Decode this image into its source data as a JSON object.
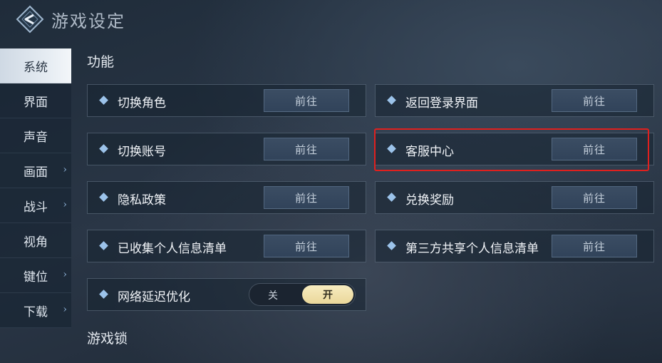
{
  "header": {
    "title": "游戏设定",
    "back_icon": "back-arrow-icon"
  },
  "sidebar": {
    "items": [
      {
        "label": "系统",
        "active": true,
        "has_chevron": false
      },
      {
        "label": "界面",
        "active": false,
        "has_chevron": false
      },
      {
        "label": "声音",
        "active": false,
        "has_chevron": false
      },
      {
        "label": "画面",
        "active": false,
        "has_chevron": true
      },
      {
        "label": "战斗",
        "active": false,
        "has_chevron": true
      },
      {
        "label": "视角",
        "active": false,
        "has_chevron": false
      },
      {
        "label": "键位",
        "active": false,
        "has_chevron": true
      },
      {
        "label": "下载",
        "active": false,
        "has_chevron": true
      }
    ],
    "chevron_glyph": "›"
  },
  "sections": {
    "function_title": "功能",
    "lock_title": "游戏锁"
  },
  "rows": {
    "switch_role": {
      "label": "切换角色",
      "button": "前往"
    },
    "back_to_login": {
      "label": "返回登录界面",
      "button": "前往"
    },
    "switch_account": {
      "label": "切换账号",
      "button": "前往"
    },
    "customer_service": {
      "label": "客服中心",
      "button": "前往"
    },
    "privacy_policy": {
      "label": "隐私政策",
      "button": "前往"
    },
    "redeem_reward": {
      "label": "兑换奖励",
      "button": "前往"
    },
    "collected_info": {
      "label": "已收集个人信息清单",
      "button": "前往"
    },
    "third_party_info": {
      "label": "第三方共享个人信息清单",
      "button": "前往"
    },
    "network_optimize": {
      "label": "网络延迟优化",
      "toggle_off": "关",
      "toggle_on": "开",
      "state": "开"
    }
  },
  "colors": {
    "accent_diamond": "#9cc3ea",
    "highlight_border": "#e0201e",
    "toggle_on": "#ead79a"
  }
}
